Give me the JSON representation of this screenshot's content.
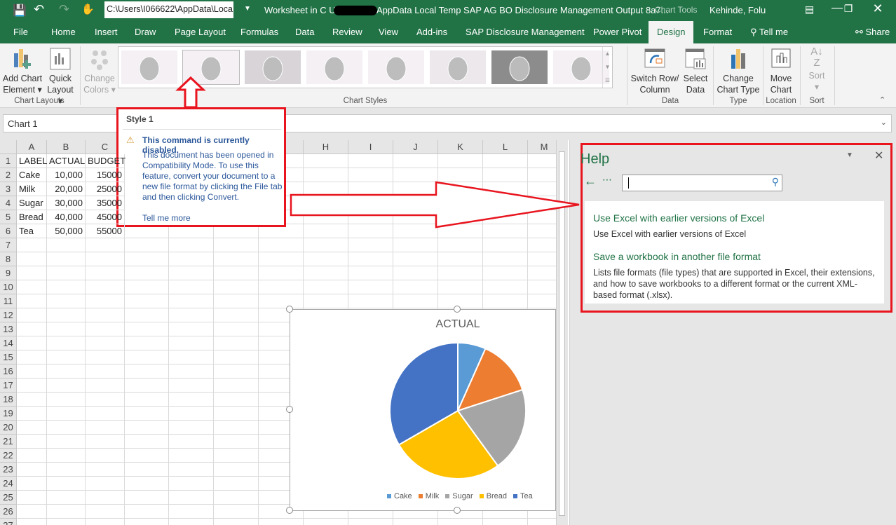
{
  "titlebar": {
    "path": "C:\\Users\\I066622\\AppData\\Loca",
    "title": "Worksheet in C  Users",
    "title_rest": "AppData Local Temp SAP AG BO Disclosure Management Output 8a7...",
    "context": "Chart Tools",
    "user": "Kehinde, Folu"
  },
  "tabs": [
    "File",
    "Home",
    "Insert",
    "Draw",
    "Page Layout",
    "Formulas",
    "Data",
    "Review",
    "View",
    "Add-ins",
    "SAP Disclosure Management",
    "Power Pivot",
    "Design",
    "Format",
    "Tell me",
    "Share"
  ],
  "ribbon": {
    "add_chart": "Add Chart",
    "add_chart2": "Element",
    "quick": "Quick",
    "quick2": "Layout",
    "change_colors": "Change",
    "change_colors2": "Colors",
    "group_layouts": "Chart Layouts",
    "group_styles": "Chart Styles",
    "switch": "Switch Row/",
    "switch2": "Column",
    "select": "Select",
    "select2": "Data",
    "group_data": "Data",
    "change_type": "Change",
    "change_type2": "Chart Type",
    "group_type": "Type",
    "move": "Move",
    "move2": "Chart",
    "group_location": "Location",
    "sort": "Sort",
    "group_sort": "Sort"
  },
  "namebox": "Chart 1",
  "columns": [
    "A",
    "B",
    "C",
    "D",
    "E",
    "F",
    "G",
    "H",
    "I",
    "J",
    "K",
    "L",
    "M"
  ],
  "cells": [
    [
      "LABEL",
      "ACTUAL",
      "BUDGET"
    ],
    [
      "Cake",
      "10,000",
      "15000"
    ],
    [
      "Milk",
      "20,000",
      "25000"
    ],
    [
      "Sugar",
      "30,000",
      "35000"
    ],
    [
      "Bread",
      "40,000",
      "45000"
    ],
    [
      "Tea",
      "50,000",
      "55000"
    ]
  ],
  "tooltip": {
    "title": "Style 1",
    "warning": "This command is currently disabled.",
    "body": "This document has been opened in Compatibility Mode. To use this feature, convert your document to a new file format by clicking the File tab and then clicking Convert.",
    "link": "Tell me more"
  },
  "help": {
    "title": "Help",
    "search_value": "",
    "results": [
      {
        "title": "Use Excel with earlier versions of Excel",
        "desc": "Use Excel with earlier versions of Excel"
      },
      {
        "title": "Save a workbook in another file format",
        "desc": "Lists file formats (file types) that are supported in Excel, their extensions, and how to save workbooks to a different format or the current XML-based format (.xlsx)."
      }
    ]
  },
  "chart_data": {
    "type": "pie",
    "title": "ACTUAL",
    "categories": [
      "Cake",
      "Milk",
      "Sugar",
      "Bread",
      "Tea"
    ],
    "values": [
      10000,
      20000,
      30000,
      40000,
      50000
    ],
    "colors": [
      "#5b9bd5",
      "#ed7d31",
      "#a5a5a5",
      "#ffc000",
      "#4472c4"
    ],
    "legend": "bottom"
  }
}
